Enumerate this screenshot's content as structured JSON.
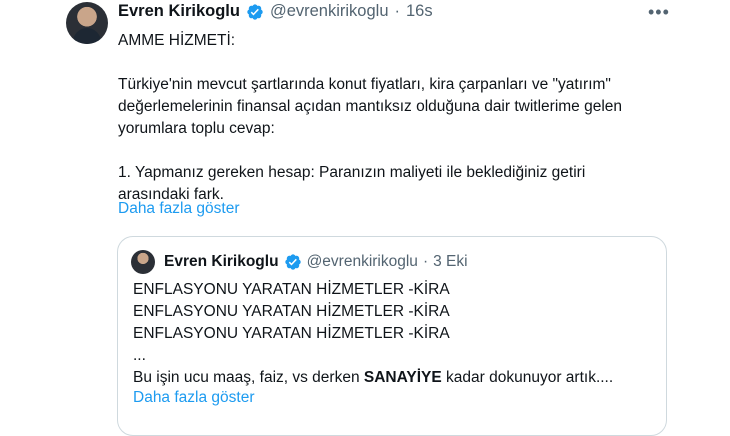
{
  "tweet": {
    "author_name": "Evren Kirikoglu",
    "author_handle": "@evrenkirikoglu",
    "separator": "·",
    "timestamp": "16s",
    "more_icon": "•••",
    "lines": [
      "AMME HİZMETİ:",
      "",
      "Türkiye'nin mevcut şartlarında konut fiyatları, kira çarpanları ve \"yatırım\"",
      "değerlemelerinin finansal açıdan mantıksız olduğuna dair twitlerime gelen",
      "yorumlara toplu cevap:",
      "",
      "1. Yapmanız gereken hesap: Paranızın maliyeti ile beklediğiniz getiri",
      "arasındaki fark."
    ],
    "show_more": "Daha fazla göster"
  },
  "quoted": {
    "author_name": "Evren Kirikoglu",
    "author_handle": "@evrenkirikoglu",
    "separator": "·",
    "timestamp": "3 Eki",
    "lines": [
      "ENFLASYONU YARATAN HİZMETLER -KİRA",
      "ENFLASYONU YARATAN HİZMETLER -KİRA",
      "ENFLASYONU YARATAN HİZMETLER -KİRA",
      "..."
    ],
    "last_line_before": "Bu işin ucu maaş, faiz, vs derken ",
    "last_line_bold": "SANAYİYE",
    "last_line_after": " kadar dokunuyor artık....",
    "show_more": "Daha fazla göster"
  },
  "colors": {
    "verified": "#1d9bf0",
    "link": "#1d9bf0",
    "secondary": "#536471"
  }
}
